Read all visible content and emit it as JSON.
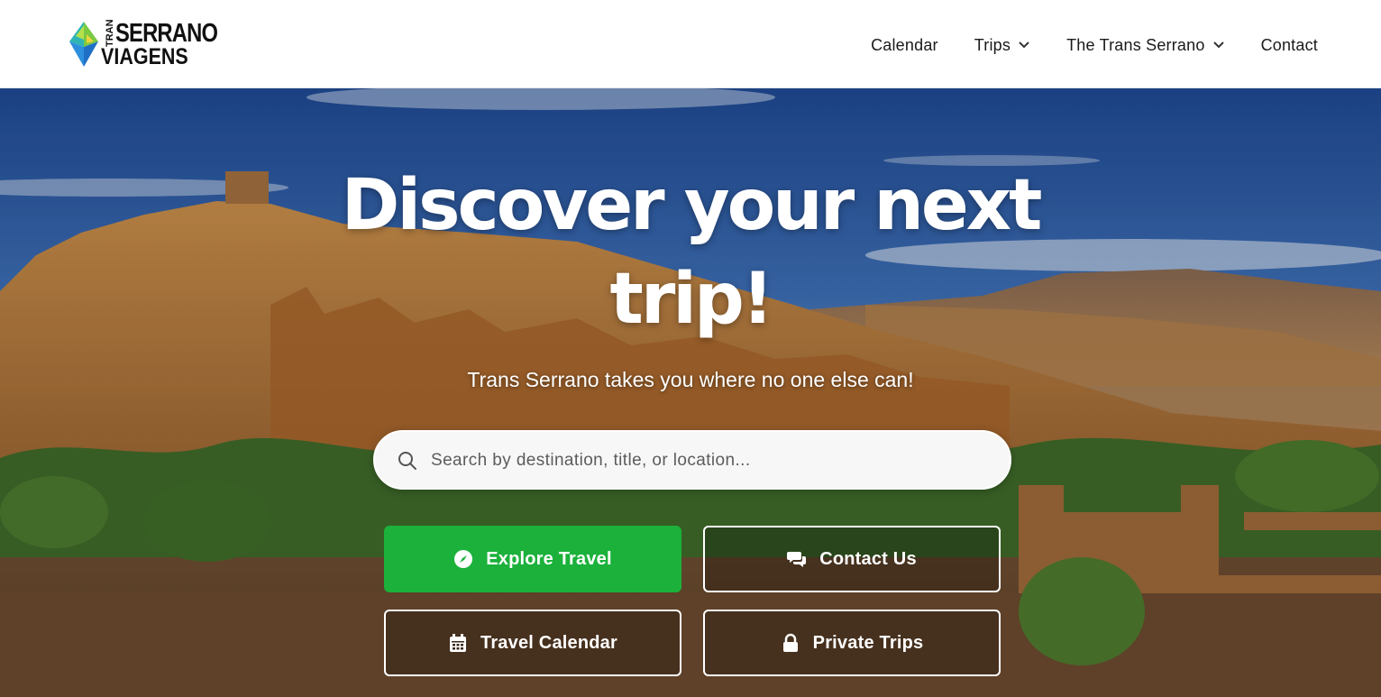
{
  "logo": {
    "top_small": "TRANS",
    "top": "SERRANO",
    "bottom": "VIAGENS",
    "colors": [
      "#7ac943",
      "#2fb5b5",
      "#2d8fdd",
      "#f0d23a"
    ]
  },
  "nav": {
    "items": [
      {
        "label": "Calendar",
        "dropdown": false
      },
      {
        "label": "Trips",
        "dropdown": true
      },
      {
        "label": "The Trans Serrano",
        "dropdown": true
      },
      {
        "label": "Contact",
        "dropdown": false
      }
    ]
  },
  "hero": {
    "title_line1": "Discover your next",
    "title_line2": "trip!",
    "subtitle": "Trans Serrano takes you where no one else can!"
  },
  "search": {
    "placeholder": "Search by destination, title, or location...",
    "value": "",
    "icon": "search-icon"
  },
  "buttons": {
    "explore": {
      "label": "Explore Travel",
      "icon": "compass-icon"
    },
    "contact": {
      "label": "Contact Us",
      "icon": "chat-bubbles-icon"
    },
    "calendar": {
      "label": "Travel Calendar",
      "icon": "calendar-icon"
    },
    "private": {
      "label": "Private Trips",
      "icon": "lock-icon"
    }
  },
  "colors": {
    "primary_green": "#1bb13b",
    "nav_text": "#1a1a1a",
    "white": "#ffffff"
  }
}
